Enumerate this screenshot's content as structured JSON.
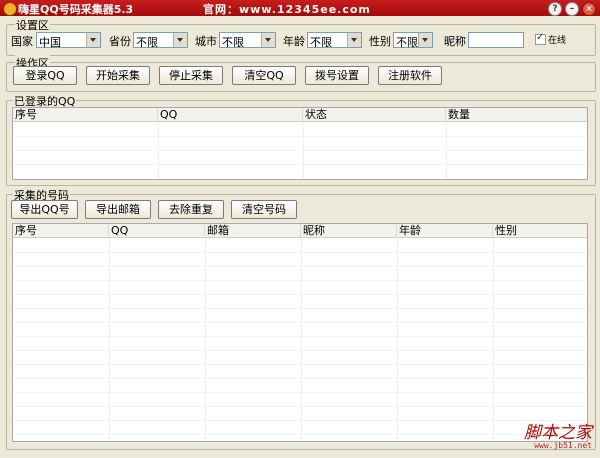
{
  "window": {
    "title": "嗨星QQ号码采集器5.3",
    "website": "官网：www.12345ee.com",
    "help_label": "?",
    "minimize_label": "–",
    "close_label": "×"
  },
  "settings": {
    "group_label": "设置区",
    "country_label": "国家",
    "country_value": "中国",
    "province_label": "省份",
    "province_value": "不限",
    "city_label": "城市",
    "city_value": "不限",
    "age_label": "年龄",
    "age_value": "不限",
    "gender_label": "性别",
    "gender_value": "不限",
    "nickname_label": "昵称",
    "nickname_value": "",
    "online_label": "在线"
  },
  "operations": {
    "group_label": "操作区",
    "buttons": [
      "登录QQ",
      "开始采集",
      "停止采集",
      "清空QQ",
      "拨号设置",
      "注册软件"
    ]
  },
  "logged_in": {
    "group_label": "已登录的QQ",
    "columns": [
      "序号",
      "QQ",
      "状态",
      "数量"
    ]
  },
  "collected": {
    "group_label": "采集的号码",
    "buttons": [
      "导出QQ号",
      "导出邮箱",
      "去除重复",
      "清空号码"
    ],
    "columns": [
      "序号",
      "QQ",
      "邮箱",
      "昵称",
      "年龄",
      "性别"
    ]
  },
  "watermark": {
    "text": "脚本之家",
    "url": "www.jb51.net"
  }
}
